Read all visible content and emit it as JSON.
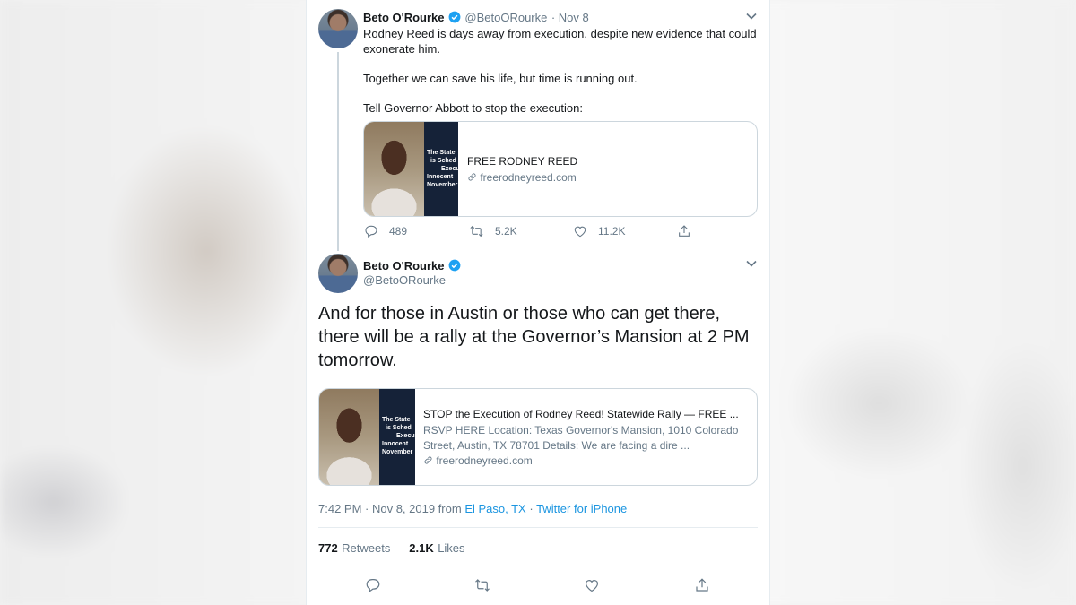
{
  "first_tweet": {
    "author_name": "Beto O'Rourke",
    "handle": "@BetoORourke",
    "date": "· Nov 8",
    "paragraphs": [
      "Rodney Reed is days away from execution, despite new evidence that could exonerate him.",
      "Together we can save his life, but time is running out.",
      "Tell Governor Abbott to stop the execution:"
    ],
    "link_card": {
      "title": "FREE RODNEY REED",
      "url": "freerodneyreed.com",
      "thumb_banner": [
        "The State",
        "is Sched",
        "Execu",
        "Innocent",
        "November"
      ]
    },
    "actions": {
      "replies": "489",
      "retweets": "5.2K",
      "likes": "11.2K"
    }
  },
  "main_tweet": {
    "author_name": "Beto O'Rourke",
    "handle": "@BetoORourke",
    "text": "And for those in Austin or those who can get there, there will be a rally at the Governor’s Mansion at 2 PM tomorrow.",
    "link_card": {
      "title": "STOP the Execution of Rodney Reed! Statewide Rally — FREE ...",
      "description": "RSVP HERE Location: Texas Governor's Mansion, 1010 Colorado Street, Austin, TX 78701 Details: We are facing a dire ...",
      "url": "freerodneyreed.com",
      "thumb_banner": [
        "The State",
        "is Sched",
        "Execu",
        "Innocent",
        "November"
      ]
    },
    "meta": {
      "time": "7:42 PM · Nov 8, 2019 from",
      "location": "El Paso, TX",
      "separator": "·",
      "source": "Twitter for iPhone"
    },
    "stats": {
      "retweets_count": "772",
      "retweets_label": "Retweets",
      "likes_count": "2.1K",
      "likes_label": "Likes"
    }
  },
  "icons": {
    "verified": "verified-badge-icon",
    "chevron": "chevron-down-icon",
    "reply": "reply-icon",
    "retweet": "retweet-icon",
    "like": "heart-icon",
    "share": "share-icon",
    "link": "link-icon"
  },
  "colors": {
    "accent": "#1da1f2",
    "link": "#1b95e0",
    "muted": "#657786",
    "text": "#14171a"
  }
}
